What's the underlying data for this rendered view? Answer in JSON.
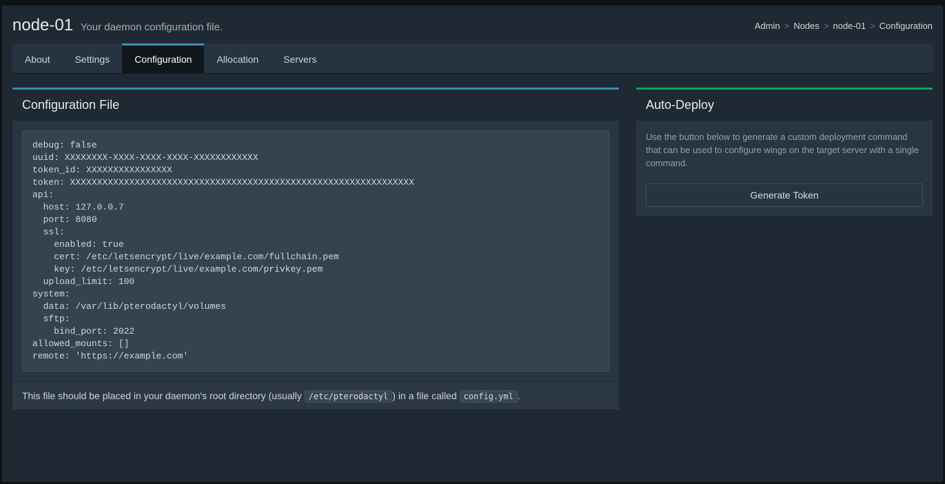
{
  "header": {
    "title": "node-01",
    "subtitle": "Your daemon configuration file."
  },
  "breadcrumb": {
    "items": [
      "Admin",
      "Nodes",
      "node-01",
      "Configuration"
    ]
  },
  "tabs": {
    "items": [
      "About",
      "Settings",
      "Configuration",
      "Allocation",
      "Servers"
    ],
    "active_index": 2
  },
  "config_box": {
    "title": "Configuration File",
    "content": "debug: false\nuuid: XXXXXXXX-XXXX-XXXX-XXXX-XXXXXXXXXXXX\ntoken_id: XXXXXXXXXXXXXXXX\ntoken: XXXXXXXXXXXXXXXXXXXXXXXXXXXXXXXXXXXXXXXXXXXXXXXXXXXXXXXXXXXXXXXX\napi:\n  host: 127.0.0.7\n  port: 8080\n  ssl:\n    enabled: true\n    cert: /etc/letsencrypt/live/example.com/fullchain.pem\n    key: /etc/letsencrypt/live/example.com/privkey.pem\n  upload_limit: 100\nsystem:\n  data: /var/lib/pterodactyl/volumes\n  sftp:\n    bind_port: 2022\nallowed_mounts: []\nremote: 'https://example.com'",
    "footer_prefix": "This file should be placed in your daemon's root directory (usually ",
    "footer_code1": "/etc/pterodactyl",
    "footer_mid": ") in a file called ",
    "footer_code2": "config.yml",
    "footer_suffix": "."
  },
  "autodeploy": {
    "title": "Auto-Deploy",
    "description": "Use the button below to generate a custom deployment command that can be used to configure wings on the target server with a single command.",
    "button_label": "Generate Token"
  }
}
